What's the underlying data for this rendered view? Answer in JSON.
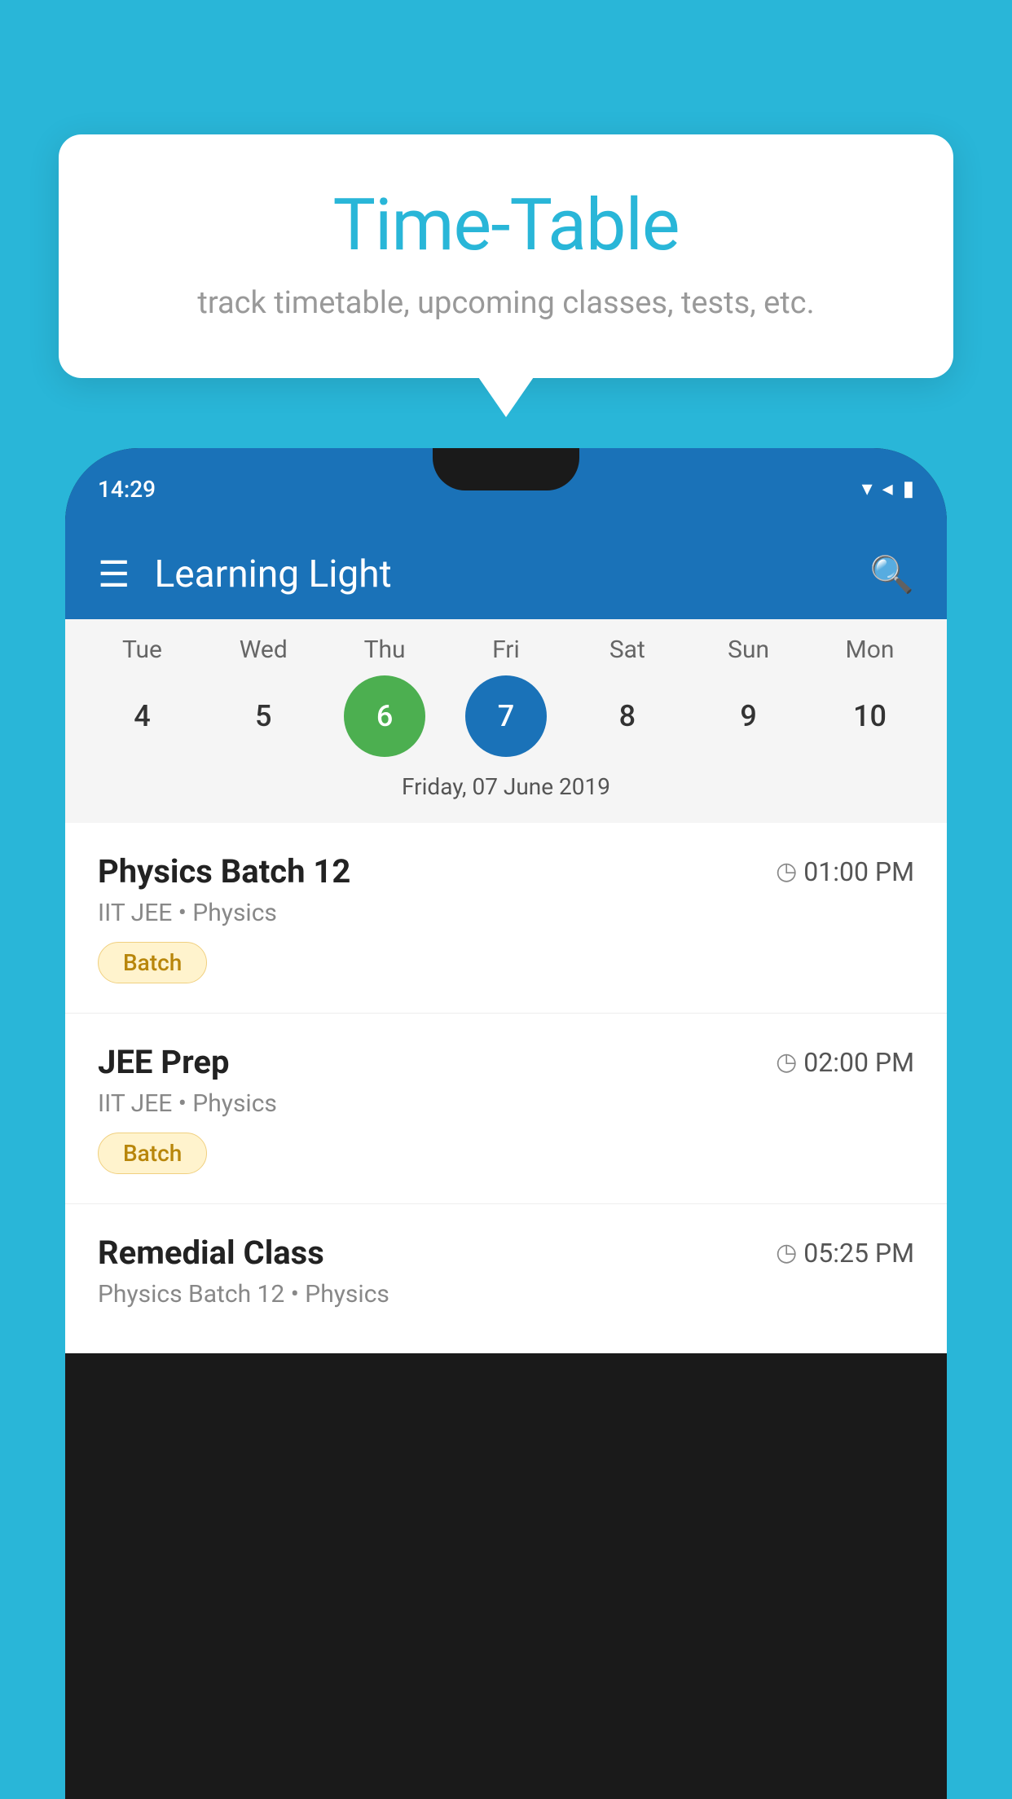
{
  "background_color": "#29B6D8",
  "speech_bubble": {
    "title": "Time-Table",
    "subtitle": "track timetable, upcoming classes, tests, etc."
  },
  "phone": {
    "status_bar": {
      "time": "14:29",
      "icons": [
        "wifi",
        "signal",
        "battery"
      ]
    },
    "app_bar": {
      "title": "Learning Light",
      "menu_icon": "☰",
      "search_icon": "🔍"
    },
    "calendar": {
      "days": [
        {
          "label": "Tue",
          "number": "4"
        },
        {
          "label": "Wed",
          "number": "5"
        },
        {
          "label": "Thu",
          "number": "6",
          "state": "today"
        },
        {
          "label": "Fri",
          "number": "7",
          "state": "selected"
        },
        {
          "label": "Sat",
          "number": "8"
        },
        {
          "label": "Sun",
          "number": "9"
        },
        {
          "label": "Mon",
          "number": "10"
        }
      ],
      "selected_date_label": "Friday, 07 June 2019"
    },
    "schedule": [
      {
        "name": "Physics Batch 12",
        "time": "01:00 PM",
        "sub": "IIT JEE • Physics",
        "badge": "Batch"
      },
      {
        "name": "JEE Prep",
        "time": "02:00 PM",
        "sub": "IIT JEE • Physics",
        "badge": "Batch"
      },
      {
        "name": "Remedial Class",
        "time": "05:25 PM",
        "sub": "Physics Batch 12 • Physics",
        "badge": null
      }
    ]
  }
}
